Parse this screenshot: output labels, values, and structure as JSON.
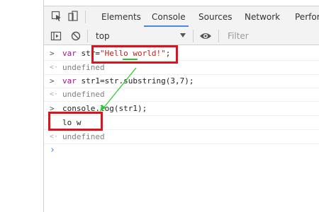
{
  "tabs": [
    {
      "label": "Elements"
    },
    {
      "label": "Console"
    },
    {
      "label": "Sources"
    },
    {
      "label": "Network"
    },
    {
      "label": "Perform"
    }
  ],
  "active_tab": "Console",
  "toolbar": {
    "context": "top",
    "filter_placeholder": "Filter"
  },
  "console": {
    "line1": {
      "kw": "var",
      "pre": " str=",
      "str": "\"Hello world!\"",
      "post": ";"
    },
    "line2": "undefined",
    "line3": {
      "kw": "var",
      "rest": " str1=str.substring(3,7);"
    },
    "line4": "undefined",
    "line5": "console.log(str1);",
    "line6": "lo w",
    "line7": "undefined"
  },
  "colors": {
    "annotation_box": "#d9141e",
    "annotation_arrow": "#22cc22",
    "tab_underline": "#4a89dc"
  }
}
